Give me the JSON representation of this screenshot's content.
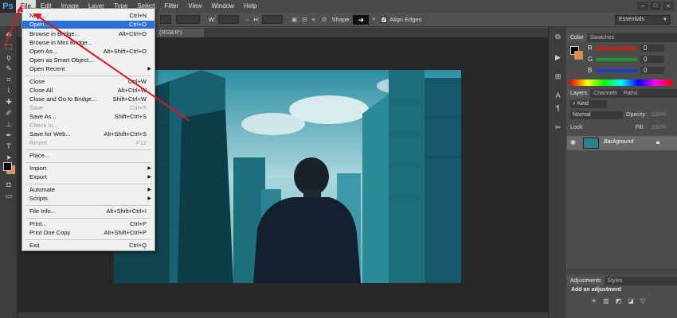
{
  "app": {
    "logo": "Ps"
  },
  "menubar": [
    "File",
    "Edit",
    "Image",
    "Layer",
    "Type",
    "Select",
    "Filter",
    "View",
    "Window",
    "Help"
  ],
  "options": {
    "w_label": "W:",
    "h_label": "H:",
    "shape_label": "Shape:",
    "align_label": "Align Edges",
    "workspace": "Essentials"
  },
  "document": {
    "tab_label": "(RGB/8*)"
  },
  "file_menu": [
    {
      "label": "New...",
      "shortcut": "Ctrl+N"
    },
    {
      "label": "Open...",
      "shortcut": "Ctrl+O"
    },
    {
      "label": "Browse in Bridge...",
      "shortcut": "Alt+Ctrl+O"
    },
    {
      "label": "Browse in Mini Bridge...",
      "shortcut": ""
    },
    {
      "label": "Open As...",
      "shortcut": "Alt+Shift+Ctrl+O"
    },
    {
      "label": "Open as Smart Object...",
      "shortcut": ""
    },
    {
      "label": "Open Recent",
      "shortcut": ""
    },
    {
      "label": "Close",
      "shortcut": "Ctrl+W"
    },
    {
      "label": "Close All",
      "shortcut": "Alt+Ctrl+W"
    },
    {
      "label": "Close and Go to Bridge...",
      "shortcut": "Shift+Ctrl+W"
    },
    {
      "label": "Save",
      "shortcut": "Ctrl+S"
    },
    {
      "label": "Save As...",
      "shortcut": "Shift+Ctrl+S"
    },
    {
      "label": "Check In...",
      "shortcut": ""
    },
    {
      "label": "Save for Web...",
      "shortcut": "Alt+Shift+Ctrl+S"
    },
    {
      "label": "Revert",
      "shortcut": "F12"
    },
    {
      "label": "Place...",
      "shortcut": ""
    },
    {
      "label": "Import",
      "shortcut": ""
    },
    {
      "label": "Export",
      "shortcut": ""
    },
    {
      "label": "Automate",
      "shortcut": ""
    },
    {
      "label": "Scripts",
      "shortcut": ""
    },
    {
      "label": "File Info...",
      "shortcut": "Alt+Shift+Ctrl+I"
    },
    {
      "label": "Print...",
      "shortcut": "Ctrl+P"
    },
    {
      "label": "Print One Copy",
      "shortcut": "Alt+Shift+Ctrl+P"
    },
    {
      "label": "Exit",
      "shortcut": "Ctrl+Q"
    }
  ],
  "color_panel": {
    "tabs": [
      "Color",
      "Swatches"
    ],
    "r_label": "R",
    "g_label": "G",
    "b_label": "B",
    "r_value": "0",
    "g_value": "0",
    "b_value": "0"
  },
  "layers_panel": {
    "tabs": [
      "Layers",
      "Channels",
      "Paths"
    ],
    "kind": "Kind",
    "blend_mode": "Normal",
    "opacity_label": "Opacity:",
    "opacity_value": "100%",
    "lock_label": "Lock:",
    "fill_label": "Fill:",
    "fill_value": "100%",
    "layer_name": "Background"
  },
  "adjustments_panel": {
    "tabs": [
      "Adjustments",
      "Styles"
    ],
    "heading": "Add an adjustment"
  },
  "colors": {
    "highlight": "#2a6fd6",
    "arrow": "#e0141e",
    "foreground": "#000000",
    "background": "#f0883a"
  }
}
